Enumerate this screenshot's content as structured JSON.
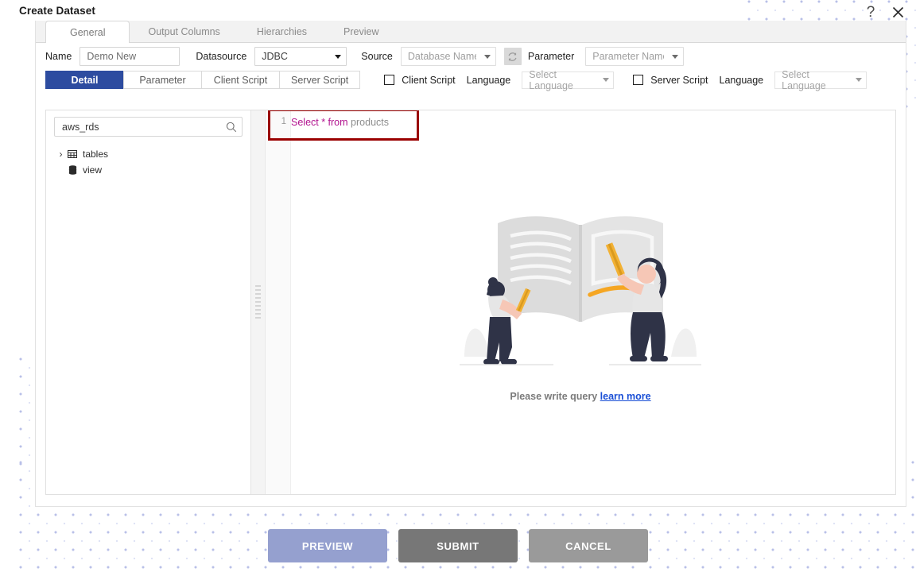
{
  "window": {
    "title": "Create Dataset",
    "help_icon": "question-mark-icon",
    "close_icon": "close-x-icon"
  },
  "main_tabs": [
    {
      "label": "General",
      "active": true
    },
    {
      "label": "Output Columns",
      "active": false
    },
    {
      "label": "Hierarchies",
      "active": false
    },
    {
      "label": "Preview",
      "active": false
    }
  ],
  "form": {
    "name_label": "Name",
    "name_value": "Demo New",
    "datasource_label": "Datasource",
    "datasource_value": "JDBC",
    "source_label": "Source",
    "source_placeholder": "Database Name",
    "refresh_icon": "refresh-icon",
    "parameter_label": "Parameter",
    "parameter_placeholder": "Parameter Name"
  },
  "sub_tabs": [
    {
      "label": "Detail",
      "active": true
    },
    {
      "label": "Parameter",
      "active": false
    },
    {
      "label": "Client Script",
      "active": false
    },
    {
      "label": "Server Script",
      "active": false
    }
  ],
  "script_options": {
    "client": {
      "checkbox_checked": false,
      "label": "Client Script",
      "language_label": "Language",
      "language_placeholder": "Select Language"
    },
    "server": {
      "checkbox_checked": false,
      "label": "Server Script",
      "language_label": "Language",
      "language_placeholder": "Select Language"
    }
  },
  "left_pane": {
    "search_value": "aws_rds",
    "search_icon": "search-icon",
    "tree": [
      {
        "label": "tables",
        "icon": "table-icon",
        "expandable": true,
        "chevron": "chevron-right-icon"
      },
      {
        "label": "view",
        "icon": "database-icon",
        "expandable": false,
        "chevron": ""
      }
    ]
  },
  "editor": {
    "line_number": "1",
    "query_keyword": "Select * from",
    "query_identifier": "products",
    "highlight_color": "#9a0000",
    "keyword_color": "#b2138f",
    "identifier_color": "#8c8c8c"
  },
  "empty_state": {
    "caption": "Please write query",
    "link_text": "learn more",
    "link_color": "#1a4fd6",
    "illustration": "two-people-writing-on-book-illustration"
  },
  "footer": {
    "preview_label": "PREVIEW",
    "submit_label": "SUBMIT",
    "cancel_label": "CANCEL",
    "preview_color": "#95a0cf",
    "submit_color": "#777777",
    "cancel_color": "#9a9a9a"
  },
  "theme": {
    "active_subtab_color": "#2d4ca0",
    "dot_pattern_color": "#b9c0e8"
  }
}
